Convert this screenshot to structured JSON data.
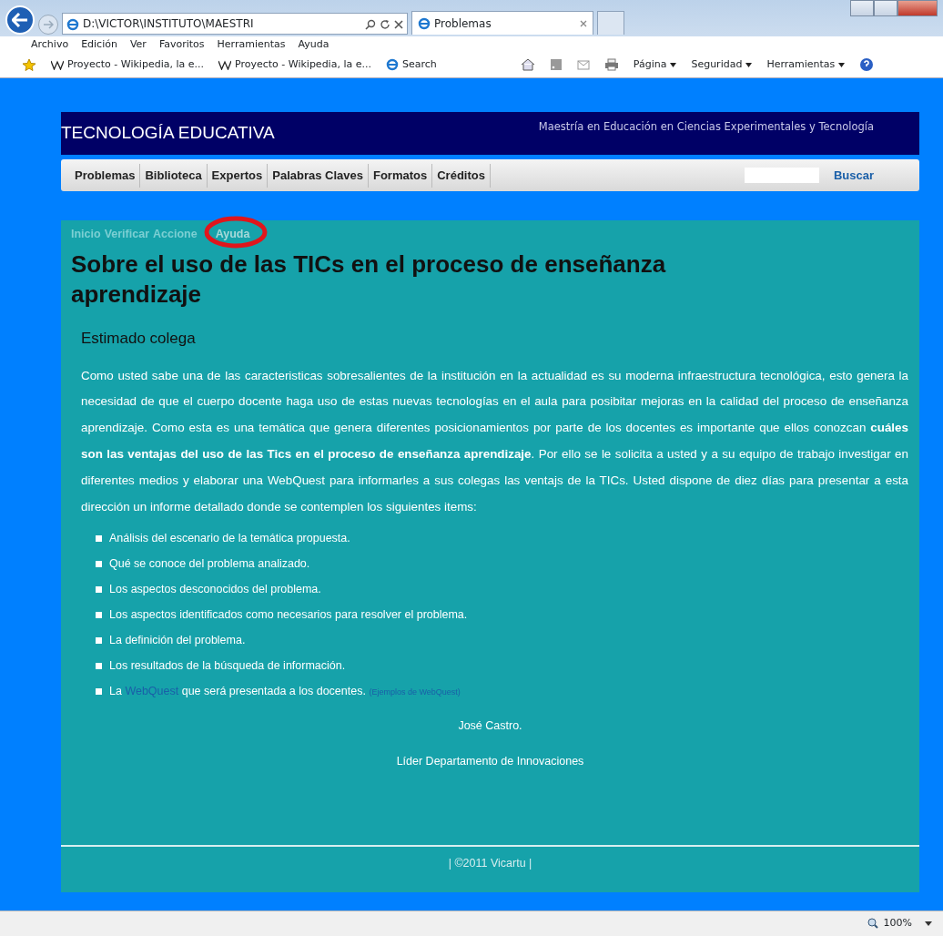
{
  "browser": {
    "address": "D:\\VICTOR\\INSTITUTO\\MAESTRI",
    "tabs": [
      {
        "label": "Problemas",
        "selected": true
      }
    ],
    "menu": [
      "Archivo",
      "Edición",
      "Ver",
      "Favoritos",
      "Herramientas",
      "Ayuda"
    ],
    "favorites": [
      {
        "label": "Proyecto - Wikipedia, la e...",
        "kind": "wiki"
      },
      {
        "label": "Proyecto - Wikipedia, la e...",
        "kind": "wiki"
      },
      {
        "label": "Search",
        "kind": "page"
      }
    ],
    "commands": [
      "Página",
      "Seguridad",
      "Herramientas"
    ],
    "zoom": "100%"
  },
  "site": {
    "title": "TECNOLOGÍA EDUCATIVA",
    "subtitle": "Maestría en Educación en Ciencias Experimentales y Tecnología",
    "nav": [
      "Problemas",
      "Biblioteca",
      "Expertos",
      "Palabras Claves",
      "Formatos",
      "Créditos"
    ],
    "search_button": "Buscar"
  },
  "breadcrumb": [
    {
      "label": "Inicio",
      "highlighted": false
    },
    {
      "label": "Verificar",
      "highlighted": false
    },
    {
      "label": "Accione",
      "highlighted": false
    },
    {
      "label": "Ayuda",
      "highlighted": true
    }
  ],
  "heading": "Sobre el uso de las TICs en el proceso de enseñanza aprendizaje",
  "greeting": "Estimado colega",
  "paragraph": "Como usted sabe una de las caracteristicas sobresalientes de la institución en la actualidad es su moderna infraestructura tecnológica, esto genera la necesidad de que el cuerpo docente haga uso de estas nuevas tecnologías en el aula para posibitar mejoras en la calidad del proceso de enseñanza aprendizaje. Como esta es una temática que genera diferentes posicionamientos por parte de los docentes es importante que ellos conozcan **cuáles son las ventajas del uso de las Tics en el proceso de enseñanza aprendizaje**. Por ello se le solicita a usted y a su equipo de trabajo investigar en diferentes medios y elaborar una WebQuest para informarles a sus colegas las ventajs de la TICs. Usted dispone de diez días para presentar a esta dirección un informe detallado donde se contemplen los siguientes items:",
  "items": [
    {
      "text": "Análisis del escenario de la temática propuesta."
    },
    {
      "text": "Qué se conoce del problema analizado."
    },
    {
      "text": "Los aspectos desconocidos del problema."
    },
    {
      "text": "Los aspectos identificados como necesarios para resolver el problema."
    },
    {
      "text": "La definición del problema."
    },
    {
      "text": "Los resultados de la búsqueda de información."
    },
    {
      "text": "La",
      "link": "WebQuest",
      "after": "que será presentada a los docentes.",
      "note_link": "(Ejemplos de WebQuest)"
    }
  ],
  "signature": "José Castro.",
  "signature_role": "Líder Departamento de Innovaciones",
  "footer": "| ©2011 Vicartu |"
}
